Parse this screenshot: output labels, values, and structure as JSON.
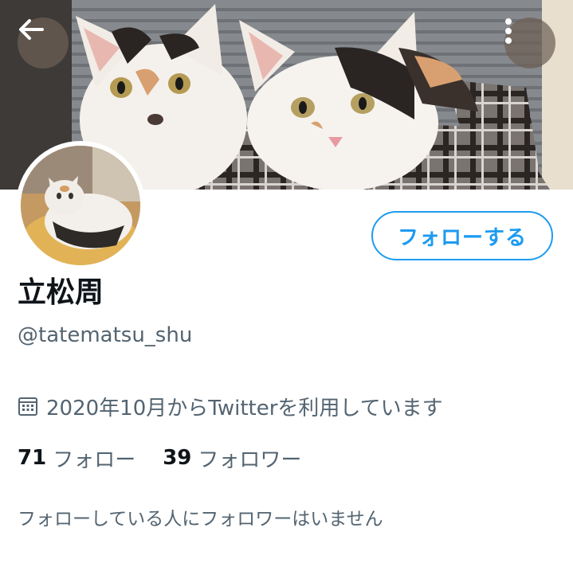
{
  "header": {
    "back_icon": "arrow-left-icon",
    "more_icon": "more-vertical-icon"
  },
  "profile": {
    "display_name": "立松周",
    "handle": "@tatematsu_shu",
    "follow_button_label": "フォローする",
    "joined_icon": "calendar-icon",
    "joined_text": "2020年10月からTwitterを利用しています",
    "following_count": "71",
    "following_label": "フォロー",
    "followers_count": "39",
    "followers_label": "フォロワー",
    "mutual_notice": "フォローしている人にフォロワーはいません"
  },
  "colors": {
    "accent": "#1d9bf0",
    "text_primary": "#0f1419",
    "text_secondary": "#536471"
  }
}
